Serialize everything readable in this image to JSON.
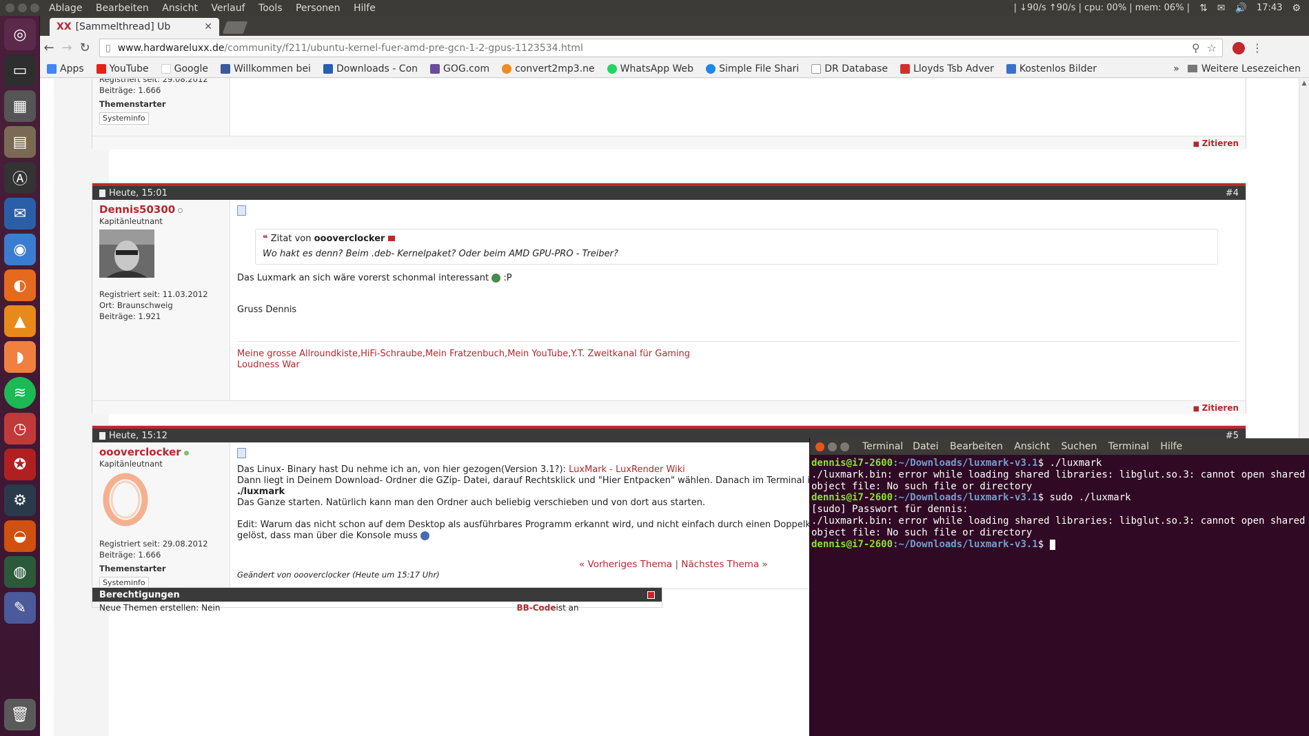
{
  "topbar": {
    "menu": [
      "Ablage",
      "Bearbeiten",
      "Ansicht",
      "Verlauf",
      "Tools",
      "Personen",
      "Hilfe"
    ],
    "sysmon": "| ↓90/s ↑90/s | cpu: 00% | mem: 06% |",
    "time": "17:43"
  },
  "browser": {
    "tab_title": "[Sammelthread] Ub",
    "url_domain": "www.hardwareluxx.de",
    "url_path": "/community/f211/ubuntu-kernel-fuer-amd-pre-gcn-1-2-gpus-1123534.html",
    "bookmarks": [
      {
        "label": "Apps",
        "color": "#4285f4"
      },
      {
        "label": "YouTube",
        "color": "#e62117"
      },
      {
        "label": "Google",
        "color": "#ffffff"
      },
      {
        "label": "Willkommen bei",
        "color": "#3b5998"
      },
      {
        "label": "Downloads - Con",
        "color": "#2a5db0"
      },
      {
        "label": "GOG.com",
        "color": "#6b4c9a"
      },
      {
        "label": "convert2mp3.ne",
        "color": "#f08a24"
      },
      {
        "label": "WhatsApp Web",
        "color": "#25d366"
      },
      {
        "label": "Simple File Shari",
        "color": "#1e88e5"
      },
      {
        "label": "DR Database",
        "color": "#ffffff"
      },
      {
        "label": "Lloyds Tsb Adver",
        "color": "#d32f2f"
      },
      {
        "label": "Kostenlos Bilder",
        "color": "#3a70c8"
      }
    ],
    "bookmarks_more": "»",
    "other_bookmarks": "Weitere Lesezeichen"
  },
  "posts": {
    "prev": {
      "registered": "Registriert seit: 29.08.2012",
      "posts": "Beiträge: 1.666",
      "badge": "Themenstarter",
      "sysinfo": "Systeminfo",
      "quote_button": "Zitieren"
    },
    "p4": {
      "date": "Heute, 15:01",
      "num": "#4",
      "user": "Dennis50300",
      "rank": "Kapitänleutnant",
      "registered": "Registriert seit: 11.03.2012",
      "location": "Ort: Braunschweig",
      "posts": "Beiträge: 1.921",
      "quote_label": "Zitat von",
      "quote_author": "oooverclocker",
      "quote_text": "Wo hakt es denn? Beim .deb- Kernelpaket? Oder beim AMD GPU-PRO - Treiber?",
      "line1": "Das Luxmark an sich wäre vorerst schonmal interessant",
      "line1_tail": ":P",
      "line2": "Gruss Dennis",
      "sig_links": [
        "Meine grosse Allroundkiste",
        "HiFi-Schraube",
        "Mein Fratzenbuch",
        "Mein YouTube",
        "Y.T. Zweitkanal für Gaming"
      ],
      "sig_line2": "Loudness War",
      "quote_button": "Zitieren"
    },
    "p5": {
      "date": "Heute, 15:12",
      "num": "#5",
      "user": "oooverclocker",
      "rank": "Kapitänleutnant",
      "registered": "Registriert seit: 29.08.2012",
      "posts": "Beiträge: 1.666",
      "badge": "Themenstarter",
      "sysinfo": "Systeminfo",
      "line1": "Das Linux- Binary hast Du nehme ich an, von hier gezogen(Version 3.1?): ",
      "line1_link": "LuxMark - LuxRender Wiki",
      "line2": "Dann liegt in Deinem Download- Ordner die GZip- Datei, darauf Rechtsklick und \"Hier Entpacken\" wählen. Danach im Terminal i",
      "line3": "./luxmark",
      "line4": "Das Ganze starten. Natürlich kann man den Ordner auch beliebig verschieben und von dort aus starten.",
      "line5": "Edit: Warum das nicht schon auf dem Desktop als ausführbares Programm erkannt wird, und nicht einfach durch einen Doppelk",
      "line6": "gelöst, dass man über die Konsole muss",
      "edited": "Geändert von oooverclocker (Heute um 15:17 Uhr)"
    }
  },
  "threadnav": {
    "prev": "« Vorheriges Thema",
    "sep": "|",
    "next": "Nächstes Thema »"
  },
  "perms": {
    "title": "Berechtigungen",
    "row_left": "Neue Themen erstellen: Nein",
    "row_right_bold": "BB-Code",
    "row_right": " ist an"
  },
  "terminal": {
    "title": "Terminal",
    "menu": [
      "Datei",
      "Bearbeiten",
      "Ansicht",
      "Suchen",
      "Terminal",
      "Hilfe"
    ],
    "user": "dennis@i7-2600",
    "path": ":~/Downloads/luxmark-v3.1",
    "cmd1": "$ ./luxmark",
    "err1": "./luxmark.bin: error while loading shared libraries: libglut.so.3: cannot open shared object file: No such file or directory",
    "cmd2": "$ sudo ./luxmark",
    "sudo": "[sudo] Passwort für dennis:",
    "err2": "./luxmark.bin: error while loading shared libraries: libglut.so.3: cannot open shared object file: No such file or directory",
    "cmd3": "$ "
  }
}
